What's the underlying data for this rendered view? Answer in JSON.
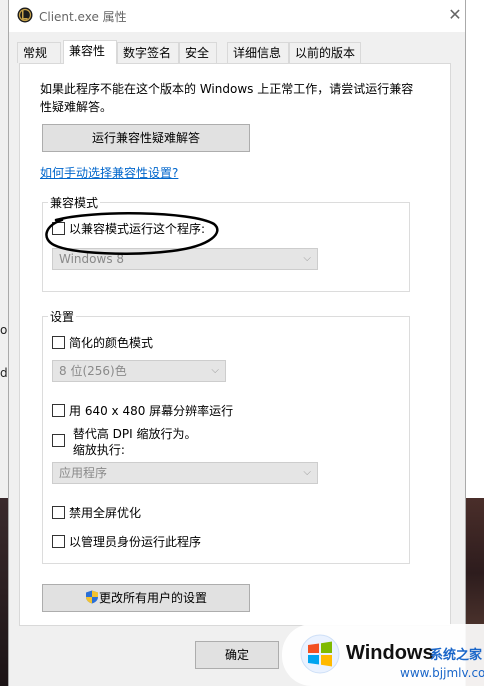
{
  "window": {
    "title": "Client.exe 属性",
    "close_glyph": "✕"
  },
  "tabs": [
    {
      "label": "常规"
    },
    {
      "label": "兼容性",
      "active": true
    },
    {
      "label": "数字签名"
    },
    {
      "label": "安全"
    },
    {
      "label": "详细信息"
    },
    {
      "label": "以前的版本"
    }
  ],
  "intro": "如果此程序不能在这个版本的 Windows 上正常工作，请尝试运行兼容性疑难解答。",
  "troubleshoot_button": "运行兼容性疑难解答",
  "manual_link": "如何手动选择兼容性设置?",
  "compat_mode": {
    "group_label": "兼容模式",
    "checkbox_label": "以兼容模式运行这个程序:",
    "checked": false,
    "select_value": "Windows 8"
  },
  "settings": {
    "group_label": "设置",
    "reduced_color_label": "简化的颜色模式",
    "color_select_value": "8 位(256)色",
    "res_640_label": "用 640 x 480 屏幕分辨率运行",
    "dpi_line1": "替代高 DPI 缩放行为。",
    "dpi_line2": "缩放执行:",
    "dpi_select_value": "应用程序",
    "fullscreen_label": "禁用全屏优化",
    "admin_label": "以管理员身份运行此程序"
  },
  "all_users_button": "更改所有用户的设置",
  "ok_button": "确定",
  "background_text": {
    "char1": "o",
    "char2": "d"
  },
  "watermark": {
    "brand": "Windows",
    "chinese": "系统之家",
    "url": "www.bjjmlv.com"
  },
  "colors": {
    "link": "#0066cc",
    "annotation_ink": "#000000",
    "watermark_blue": "#1a66c9"
  }
}
